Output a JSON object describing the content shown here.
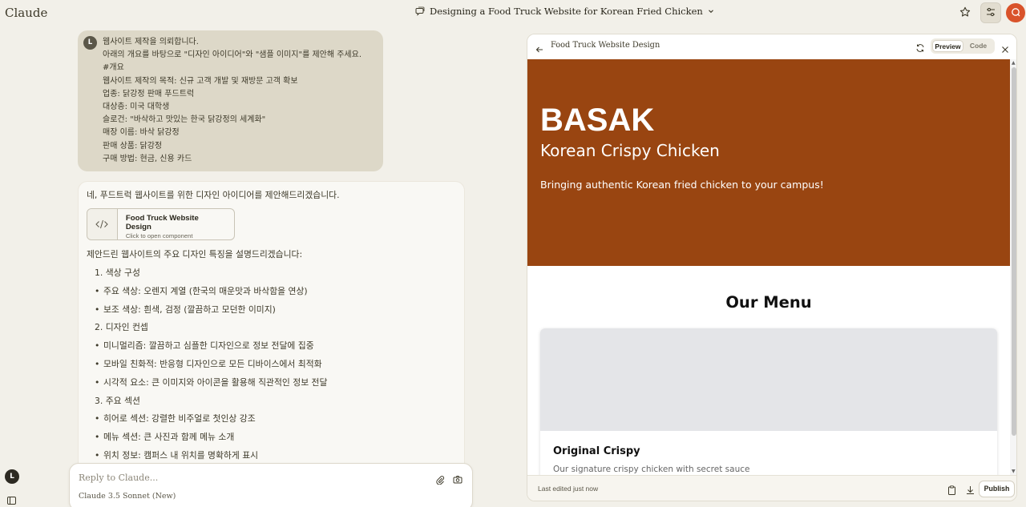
{
  "app": {
    "brand": "Claude"
  },
  "conversation": {
    "title": "Designing a Food Truck Website for Korean Fried Chicken"
  },
  "user": {
    "initial": "L"
  },
  "user_message": {
    "lines": [
      "웹사이트 제작을 의뢰합니다.",
      "아래의 개요를 바탕으로 \"디자인 아이디어\"와 \"샘플 이미지\"를 제안해 주세요.",
      "#개요",
      "웹사이트 제작의 목적: 신규 고객 개발 및 재방문 고객 확보",
      "업종: 닭강정 판매 푸드트럭",
      "대상층: 미국 대학생",
      "슬로건: \"바삭하고 맛있는 한국 닭강정의 세계화\"",
      "매장 이름: 바삭 닭강정",
      "판매 상품: 닭강정",
      "구매 방법: 현금, 신용 카드"
    ]
  },
  "assistant_message": {
    "intro": "네, 푸드트럭 웹사이트를 위한 디자인 아이디어를 제안해드리겠습니다.",
    "artifact_card": {
      "title": "Food Truck Website Design",
      "subtitle": "Click to open component"
    },
    "features_intro": "제안드린 웹사이트의 주요 디자인 특징을 설명드리겠습니다:",
    "list": [
      {
        "type": "num",
        "text": "1. 색상 구성"
      },
      {
        "type": "bullet",
        "text": "주요 색상: 오렌지 계열 (한국의 매운맛과 바삭함을 연상)"
      },
      {
        "type": "bullet",
        "text": "보조 색상: 흰색, 검정 (깔끔하고 모던한 이미지)"
      },
      {
        "type": "num",
        "text": "2. 디자인 컨셉"
      },
      {
        "type": "bullet",
        "text": "미니멀리즘: 깔끔하고 심플한 디자인으로 정보 전달에 집중"
      },
      {
        "type": "bullet",
        "text": "모바일 친화적: 반응형 디자인으로 모든 디바이스에서 최적화"
      },
      {
        "type": "bullet",
        "text": "시각적 요소: 큰 이미지와 아이콘을 활용해 직관적인 정보 전달"
      },
      {
        "type": "num",
        "text": "3. 주요 섹션"
      },
      {
        "type": "bullet",
        "text": "히어로 섹션: 강렬한 비주얼로 첫인상 강조"
      },
      {
        "type": "bullet",
        "text": "메뉴 섹션: 큰 사진과 함께 메뉴 소개"
      },
      {
        "type": "bullet",
        "text": "위치 정보: 캠퍼스 내 위치를 명확하게 표시"
      }
    ]
  },
  "reply": {
    "placeholder": "Reply to Claude...",
    "model": "Claude 3.5 Sonnet (New)"
  },
  "artifact_panel": {
    "title": "Food Truck Website Design",
    "toggle": {
      "preview": "Preview",
      "code": "Code",
      "selected": "Preview"
    },
    "footer": {
      "edited": "Last edited just now",
      "publish": "Publish"
    },
    "preview": {
      "hero": {
        "title": "BASAK",
        "subtitle": "Korean Crispy Chicken",
        "tagline": "Bringing authentic Korean fried chicken to your campus!"
      },
      "menu": {
        "heading": "Our Menu",
        "items": [
          {
            "name": "Original Crispy",
            "description": "Our signature crispy chicken with secret sauce"
          }
        ]
      }
    }
  },
  "icons": {
    "chat": "chat-bubble-icon",
    "chevron": "chevron-down-icon",
    "star": "star-icon",
    "settings": "sliders-icon",
    "profile": "claude-logo-icon",
    "attach": "paperclip-icon",
    "camera": "camera-icon",
    "code": "code-icon",
    "back": "arrow-left-icon",
    "refresh": "refresh-icon",
    "close": "close-icon",
    "copy": "clipboard-icon",
    "download": "download-icon",
    "sidebar": "sidebar-icon"
  },
  "colors": {
    "hero_bg": "#994511",
    "app_bg": "#f2f0e9",
    "accent": "#d9532b"
  }
}
